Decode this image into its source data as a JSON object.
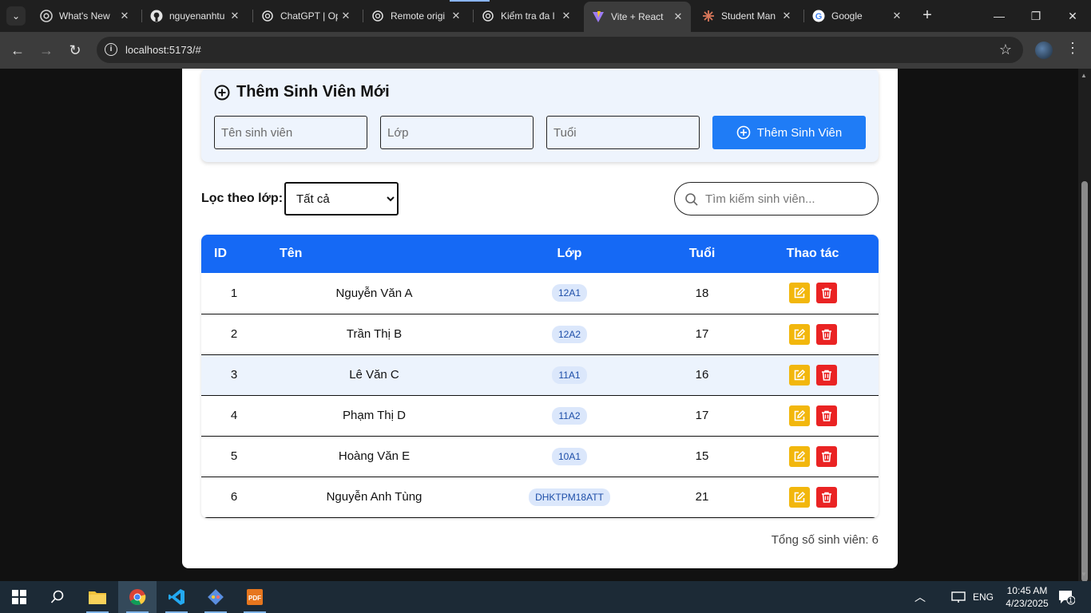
{
  "browser": {
    "tabs": [
      {
        "title": "What's New",
        "favicon": "chrome-icon",
        "active": false
      },
      {
        "title": "nguyenanhtu",
        "favicon": "github-icon",
        "active": false
      },
      {
        "title": "ChatGPT | Op",
        "favicon": "chatgpt-icon",
        "active": false
      },
      {
        "title": "Remote origi",
        "favicon": "chatgpt-icon",
        "active": false
      },
      {
        "title": "Kiểm tra đa l",
        "favicon": "chatgpt-icon",
        "active": false
      },
      {
        "title": "Vite + React",
        "favicon": "vite-icon",
        "active": true
      },
      {
        "title": "Student Man",
        "favicon": "claude-icon",
        "active": false
      },
      {
        "title": "Google",
        "favicon": "google-icon",
        "active": false
      }
    ],
    "url": "localhost:5173/#"
  },
  "add_form": {
    "title": "Thêm Sinh Viên Mới",
    "name_placeholder": "Tên sinh viên",
    "class_placeholder": "Lớp",
    "age_placeholder": "Tuổi",
    "submit_label": "Thêm Sinh Viên"
  },
  "filter": {
    "label": "Lọc theo lớp:",
    "selected": "Tất cả"
  },
  "search": {
    "placeholder": "Tìm kiếm sinh viên..."
  },
  "table": {
    "headers": {
      "id": "ID",
      "name": "Tên",
      "class": "Lớp",
      "age": "Tuổi",
      "actions": "Thao tác"
    },
    "rows": [
      {
        "id": "1",
        "name": "Nguyễn Văn A",
        "class": "12A1",
        "age": "18",
        "highlighted": false
      },
      {
        "id": "2",
        "name": "Trần Thị B",
        "class": "12A2",
        "age": "17",
        "highlighted": false
      },
      {
        "id": "3",
        "name": "Lê Văn C",
        "class": "11A1",
        "age": "16",
        "highlighted": true
      },
      {
        "id": "4",
        "name": "Phạm Thị D",
        "class": "11A2",
        "age": "17",
        "highlighted": false
      },
      {
        "id": "5",
        "name": "Hoàng Văn E",
        "class": "10A1",
        "age": "15",
        "highlighted": false
      },
      {
        "id": "6",
        "name": "Nguyễn Anh Tùng",
        "class": "DHKTPM18ATT",
        "age": "21",
        "highlighted": false
      }
    ]
  },
  "total_label": "Tổng số sinh viên: 6",
  "taskbar": {
    "language": "ENG",
    "time": "10:45 AM",
    "date": "4/23/2025",
    "notification_count": "1"
  },
  "colors": {
    "primary": "#1f7cf6",
    "table_header": "#1569f5",
    "edit": "#f2b70d",
    "delete": "#ea2323",
    "badge_bg": "#dbe7fb"
  }
}
